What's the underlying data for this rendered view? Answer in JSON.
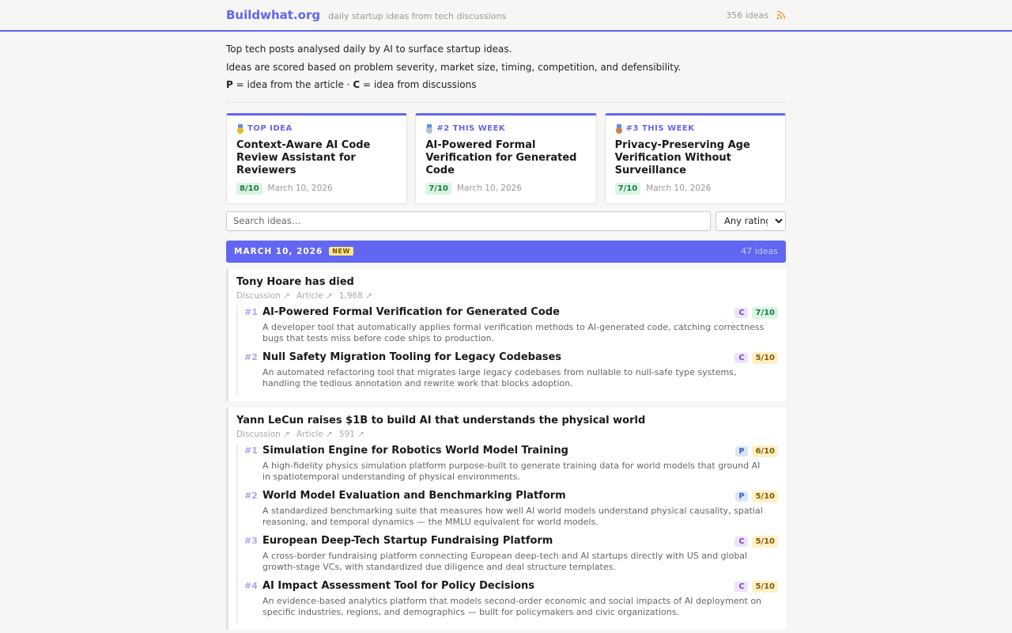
{
  "header": {
    "site_name": "Buildwhat.org",
    "tagline": "daily startup ideas from tech discussions",
    "count": "356 ideas",
    "rss_icon": "rss-icon"
  },
  "intro": {
    "line1": "Top tech posts analysed daily by AI to surface startup ideas.",
    "line2": "Ideas are scored based on problem severity, market size, timing, competition, and defensibility.",
    "p_key": "P",
    "p_text": " = idea from the article · ",
    "c_key": "C",
    "c_text": " = idea from discussions"
  },
  "featured": [
    {
      "kicker": "Top idea",
      "title": "Context-Aware AI Code Review Assistant for Reviewers",
      "score": "8/10",
      "date": "March 10, 2026",
      "medal_color": "#e8b923"
    },
    {
      "kicker": "#2 this week",
      "title": "AI-Powered Formal Verification for Generated Code",
      "score": "7/10",
      "date": "March 10, 2026",
      "medal_color": "#b8c0cc"
    },
    {
      "kicker": "#3 this week",
      "title": "Privacy-Preserving Age Verification Without Surveillance",
      "score": "7/10",
      "date": "March 10, 2026",
      "medal_color": "#c9834a"
    }
  ],
  "filters": {
    "search_placeholder": "Search ideas…",
    "rating_selected": "Any rating"
  },
  "day": {
    "date": "MARCH 10, 2026",
    "badge": "NEW",
    "count": "47 ideas"
  },
  "stories": [
    {
      "title": "Tony Hoare has died",
      "discussion": "Discussion ↗",
      "article": "Article ↗",
      "points": "1,968 ↗",
      "ideas": [
        {
          "num": "#1",
          "title": "AI-Powered Formal Verification for Generated Code",
          "src": "C",
          "score": "7/10",
          "score_type": "green",
          "desc": "A developer tool that automatically applies formal verification methods to AI-generated code, catching correctness bugs that tests miss before code ships to production."
        },
        {
          "num": "#2",
          "title": "Null Safety Migration Tooling for Legacy Codebases",
          "src": "C",
          "score": "5/10",
          "score_type": "yellow",
          "desc": "An automated refactoring tool that migrates large legacy codebases from nullable to null-safe type systems, handling the tedious annotation and rewrite work that blocks adoption."
        }
      ]
    },
    {
      "title": "Yann LeCun raises $1B to build AI that understands the physical world",
      "discussion": "Discussion ↗",
      "article": "Article ↗",
      "points": "591 ↗",
      "ideas": [
        {
          "num": "#1",
          "title": "Simulation Engine for Robotics World Model Training",
          "src": "P",
          "score": "6/10",
          "score_type": "yellow",
          "desc": "A high-fidelity physics simulation platform purpose-built to generate training data for world models that ground AI in spatiotemporal understanding of physical environments."
        },
        {
          "num": "#2",
          "title": "World Model Evaluation and Benchmarking Platform",
          "src": "P",
          "score": "5/10",
          "score_type": "yellow",
          "desc": "A standardized benchmarking suite that measures how well AI world models understand physical causality, spatial reasoning, and temporal dynamics — the MMLU equivalent for world models."
        },
        {
          "num": "#3",
          "title": "European Deep-Tech Startup Fundraising Platform",
          "src": "C",
          "score": "5/10",
          "score_type": "yellow",
          "desc": "A cross-border fundraising platform connecting European deep-tech and AI startups directly with US and global growth-stage VCs, with standardized due diligence and deal structure templates."
        },
        {
          "num": "#4",
          "title": "AI Impact Assessment Tool for Policy Decisions",
          "src": "C",
          "score": "5/10",
          "score_type": "yellow",
          "desc": "An evidence-based analytics platform that models second-order economic and social impacts of AI deployment on specific industries, regions, and demographics — built for policymakers and civic organizations."
        }
      ]
    }
  ]
}
